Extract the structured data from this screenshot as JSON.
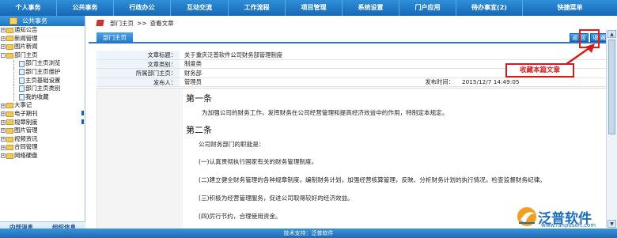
{
  "topnav": {
    "items": [
      "个人事务",
      "公共事务",
      "行政办公",
      "互动交流",
      "工作流程",
      "项目管理",
      "系统设置",
      "门户应用",
      "待办事宜(2)",
      "快捷菜单"
    ]
  },
  "sidebar": {
    "title": "公共事务",
    "tree": [
      {
        "label": "通知公告",
        "type": "folder"
      },
      {
        "label": "新闻管理",
        "type": "folder"
      },
      {
        "label": "图片新闻",
        "type": "folder"
      },
      {
        "label": "部门主页",
        "type": "folder"
      },
      {
        "label": "部门主页浏览",
        "type": "doc",
        "child": true
      },
      {
        "label": "部门主页维护",
        "type": "doc",
        "child": true
      },
      {
        "label": "主页基础设置",
        "type": "doc",
        "child": true
      },
      {
        "label": "部门主页类别",
        "type": "doc",
        "child": true
      },
      {
        "label": "我的收藏",
        "type": "doc",
        "child": true
      },
      {
        "label": "大事记",
        "type": "folder"
      },
      {
        "label": "电子期刊",
        "type": "folder"
      },
      {
        "label": "规章制度",
        "type": "folder"
      },
      {
        "label": "图片管理",
        "type": "folder"
      },
      {
        "label": "视频资讯",
        "type": "folder"
      },
      {
        "label": "合同管理",
        "type": "folder"
      },
      {
        "label": "网络硬盘",
        "type": "folder"
      }
    ],
    "footer": {
      "left": "内部消息",
      "right": "组织信息"
    }
  },
  "breadcrumb": {
    "first": "部门主页",
    "sep": ">>",
    "second": "查看文章"
  },
  "tab": {
    "label": "部门主页"
  },
  "actions": {
    "back": "返 回",
    "favorite": "收 藏"
  },
  "meta": {
    "title_key": "文章标题：",
    "title_val": "关于重庆泛普软件公司财务部管理制度",
    "cat_key": "文章类别：",
    "cat_val": "制度类",
    "dept_key": "所属部门主页：",
    "dept_val": "财务部",
    "author_key": "发布人：",
    "author_val": "管理员",
    "time_key": "发布时间：",
    "time_val": "2015/12/7 14:49:05"
  },
  "content": {
    "h1": "第一条",
    "p1": "为加强公司的财务工作，发挥财务在公司经营管理和提高经济效益中的作用，特制定本规定。",
    "h2": "第二条",
    "p2": "公司财务部门的职能是：",
    "p3": "(一)认真贯彻执行国家有关的财务管理制度。",
    "p4": "(二)建立健全财务管理的各种规章制度，编制财务计划，加强经营核算管理，反映、分析财务计划的执行情况，检查监督财务纪律。",
    "p5": "(三)积极为经营管理服务，促进公司取得较好的经济效益。",
    "p6": "(四)厉行节约，合理使用资金。"
  },
  "callout": {
    "text": "收藏本篇文章"
  },
  "footer": {
    "text": "技术支持：泛普软件"
  },
  "logo": {
    "name": "泛普软件",
    "url": "www.fanpusoft.com"
  },
  "colors": {
    "nav": "#1f74c2",
    "highlight": "#e21b1b"
  }
}
